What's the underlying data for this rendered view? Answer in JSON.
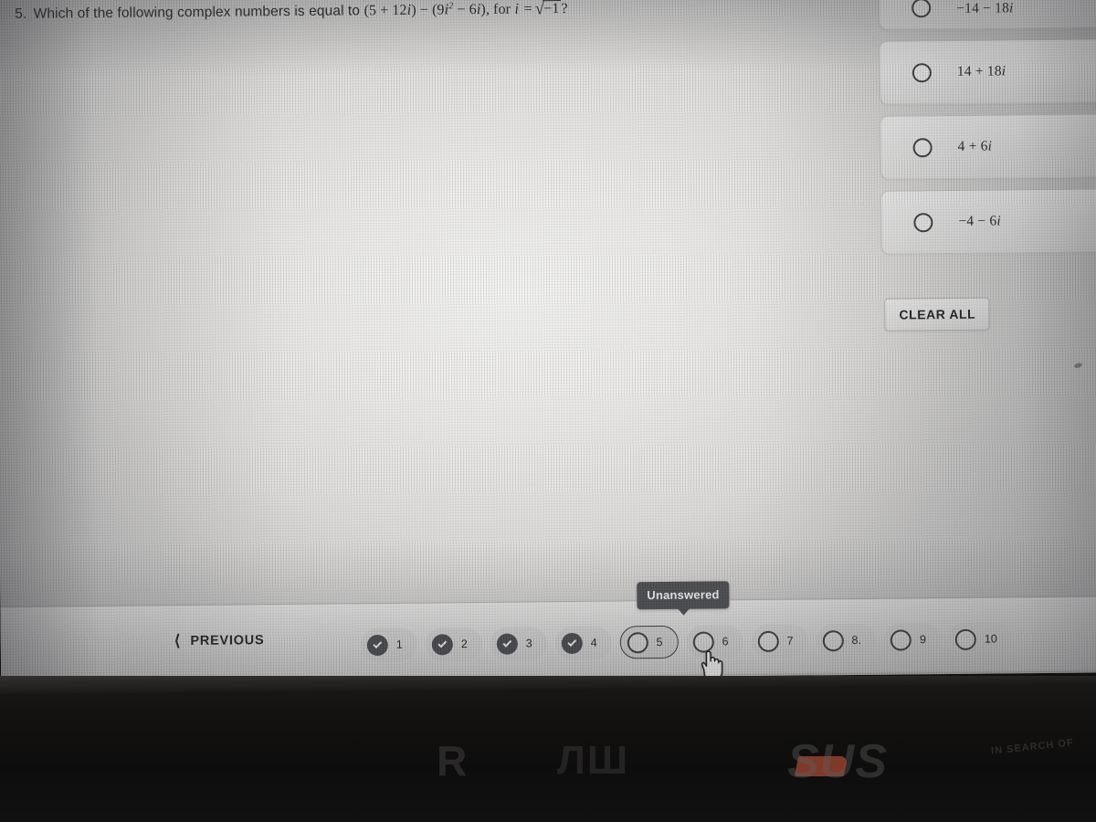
{
  "question": {
    "number": "5.",
    "prefix": "Which of the following complex numbers is equal to",
    "expr_open": "(5 + 12",
    "expr_i1": "i",
    "expr_mid": ") − (9",
    "expr_i2": "i",
    "expr_exp": "2",
    "expr_mid2": " − 6",
    "expr_i3": "i",
    "expr_close": "), for",
    "var_i": "i",
    "equals": "=",
    "radical": "√",
    "radicand": "−1",
    "qmark": "?"
  },
  "options": [
    {
      "label": "−14 − 18",
      "imag": "i",
      "selected": false
    },
    {
      "label": "14 + 18",
      "imag": "i",
      "selected": false
    },
    {
      "label": "4 + 6",
      "imag": "i",
      "selected": false
    },
    {
      "label": "−4 − 6",
      "imag": "i",
      "selected": false
    }
  ],
  "clear_all_label": "CLEAR ALL",
  "footer": {
    "previous_label": "PREVIOUS",
    "tooltip": "Unanswered",
    "pills": [
      {
        "num": "1",
        "state": "answered"
      },
      {
        "num": "2",
        "state": "answered"
      },
      {
        "num": "3",
        "state": "answered"
      },
      {
        "num": "4",
        "state": "answered"
      },
      {
        "num": "5",
        "state": "unanswered",
        "current": true
      },
      {
        "num": "6",
        "state": "unanswered"
      },
      {
        "num": "7",
        "state": "unanswered"
      },
      {
        "num": "8.",
        "state": "unanswered"
      },
      {
        "num": "9",
        "state": "unanswered"
      },
      {
        "num": "10",
        "state": "unanswered"
      }
    ]
  },
  "bezel": {
    "brand_mirrored": "Я",
    "brand_middle": "ЛШ",
    "brand_asus": "SUS",
    "brand_sub": "IN SEARCH OF"
  },
  "colors": {
    "text": "#25262a",
    "tooltip_bg": "#4d4e52",
    "answered_mark": "#4a4b4f",
    "bezel": "#121111",
    "brand_accent": "#c4563c"
  }
}
